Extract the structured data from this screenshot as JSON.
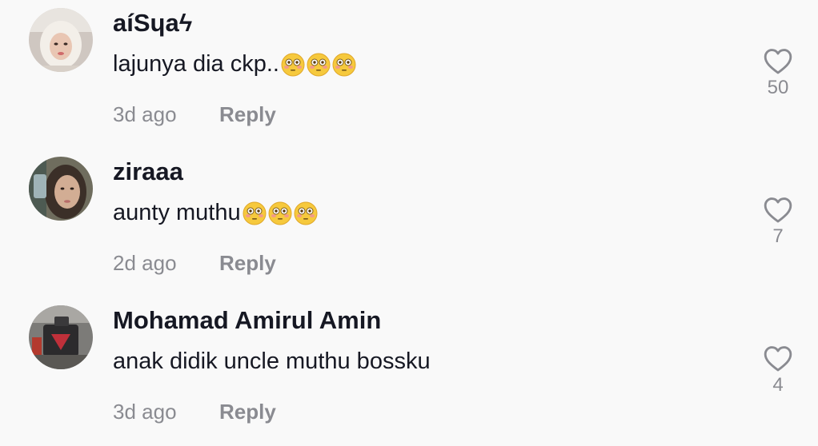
{
  "comments": [
    {
      "username": "aíSɥaϟ",
      "text": "lajunya dia ckp..",
      "emoji_count": 3,
      "emoji_icon": "flushed-face-icon",
      "time": "3d ago",
      "reply_label": "Reply",
      "likes": "50"
    },
    {
      "username": "ziraaa",
      "text": "aunty muthu",
      "emoji_count": 3,
      "emoji_icon": "flushed-face-icon",
      "time": "2d ago",
      "reply_label": "Reply",
      "likes": "7"
    },
    {
      "username": "Mohamad Amirul Amin",
      "text": "anak didik uncle muthu bossku",
      "emoji_count": 0,
      "time": "3d ago",
      "reply_label": "Reply",
      "likes": "4"
    }
  ],
  "colors": {
    "background": "#f9f9f9",
    "primary_text": "#161823",
    "secondary_text": "#8a8b91",
    "like_icon": "#8a8b91"
  },
  "icons": {
    "like": "heart-outline-icon"
  }
}
